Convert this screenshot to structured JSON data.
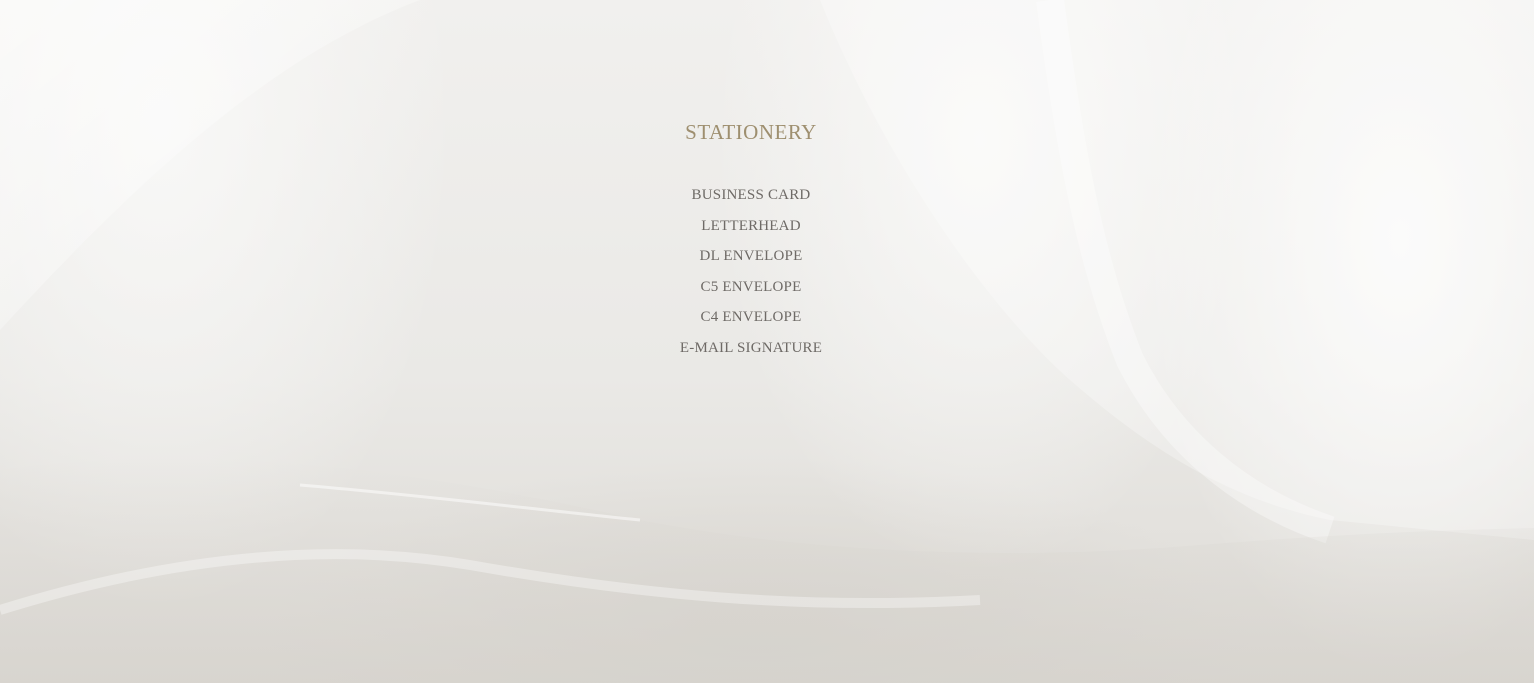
{
  "menu": {
    "title": "STATIONERY",
    "items": [
      {
        "label": "BUSINESS CARD"
      },
      {
        "label": "LETTERHEAD"
      },
      {
        "label": "DL ENVELOPE"
      },
      {
        "label": "C5 ENVELOPE"
      },
      {
        "label": "C4 ENVELOPE"
      },
      {
        "label": "E-MAIL SIGNATURE"
      }
    ]
  },
  "colors": {
    "title": "#9e8f6f",
    "link": "#6e6a66",
    "background": "#ecebe8"
  }
}
